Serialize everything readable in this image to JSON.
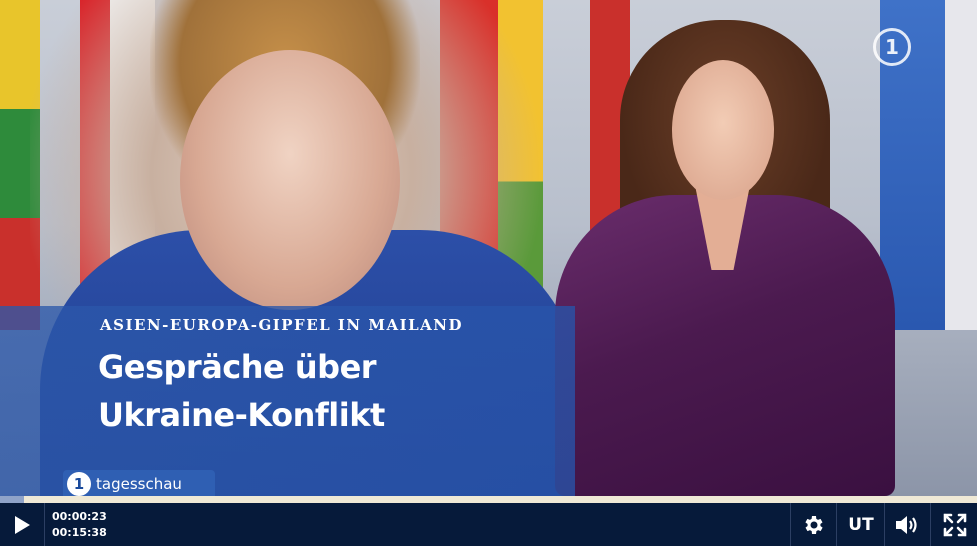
{
  "overlay": {
    "kicker": "ASIEN-EUROPA-GIPFEL IN MAILAND",
    "headline_line1": "Gespräche über",
    "headline_line2": "Ukraine-Konflikt"
  },
  "brand": {
    "logo_glyph": "1",
    "name": "tagesschau"
  },
  "channel_bug": {
    "glyph": "1"
  },
  "player": {
    "current_time": "00:00:23",
    "duration": "00:15:38",
    "progress_fraction": 0.0245,
    "subtitles_label": "UT",
    "icons": [
      "play-icon",
      "gear-icon",
      "speaker-icon",
      "fullscreen-icon"
    ]
  },
  "colors": {
    "control_bar": "#061a3a",
    "progress_track": "#efe9d6",
    "headline_band": "#2c58aa"
  }
}
